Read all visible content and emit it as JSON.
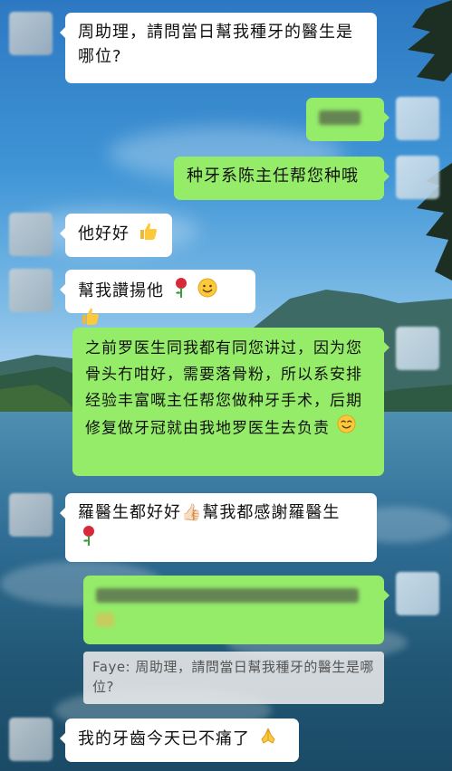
{
  "messages": {
    "m1": {
      "text": "周助理，請問當日幫我種牙的醫生是哪位?"
    },
    "m3": {
      "text": "种牙系陈主任帮您种哦"
    },
    "m4": {
      "text": "他好好"
    },
    "m5": {
      "text": "幫我讚揚他"
    },
    "m6": {
      "text": "之前罗医生同我都有同您讲过，因为您骨头冇咁好，需要落骨粉，所以系安排经验丰富嘅主任帮您做种牙手术，后期修复做牙冠就由我地罗医生去负责"
    },
    "m7": {
      "text": "羅醫生都好好👍🏻幫我都感謝羅醫生"
    },
    "m8": {
      "quote": "Faye: 周助理，請問當日幫我種牙的醫生是哪位?"
    },
    "m9": {
      "text": "我的牙齒今天已不痛了"
    }
  },
  "icons": [
    "thumbs-up-icon",
    "rose-icon",
    "smiling-face-icon",
    "praying-hands-icon"
  ],
  "colors": {
    "sent_bubble": "#95ec69",
    "received_bubble": "#ffffff"
  }
}
